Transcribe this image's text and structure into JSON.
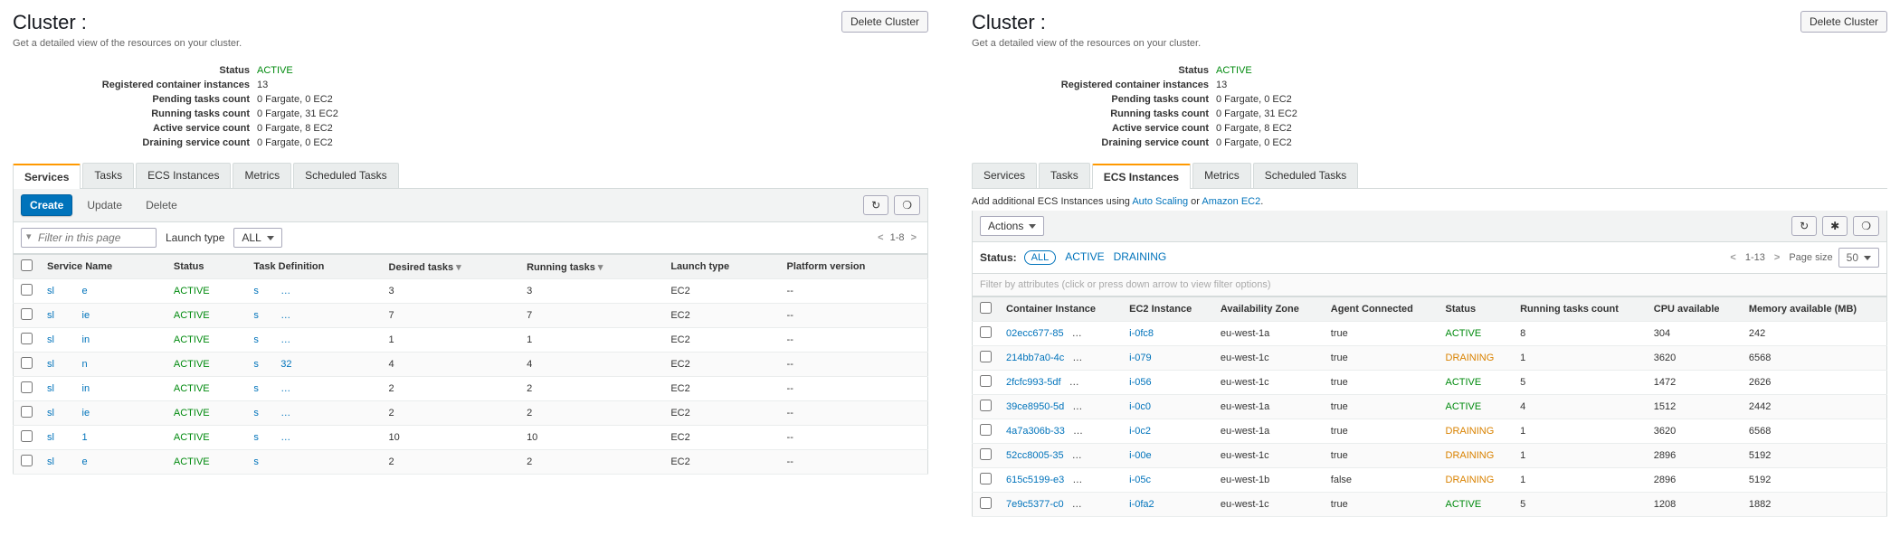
{
  "left": {
    "title": "Cluster :",
    "delete_btn": "Delete Cluster",
    "subtitle": "Get a detailed view of the resources on your cluster.",
    "meta": [
      {
        "label": "Status",
        "value": "ACTIVE",
        "green": true
      },
      {
        "label": "Registered container instances",
        "value": "13"
      },
      {
        "label": "Pending tasks count",
        "value": "0 Fargate, 0 EC2"
      },
      {
        "label": "Running tasks count",
        "value": "0 Fargate, 31 EC2"
      },
      {
        "label": "Active service count",
        "value": "0 Fargate, 8 EC2"
      },
      {
        "label": "Draining service count",
        "value": "0 Fargate, 0 EC2"
      }
    ],
    "tabs": [
      "Services",
      "Tasks",
      "ECS Instances",
      "Metrics",
      "Scheduled Tasks"
    ],
    "active_tab": 0,
    "toolbar": {
      "create": "Create",
      "update": "Update",
      "delete": "Delete"
    },
    "filter": {
      "placeholder": "Filter in this page",
      "launch_label": "Launch type",
      "launch_value": "ALL",
      "pager": "1-8"
    },
    "cols": [
      "",
      "Service Name",
      "Status",
      "Task Definition",
      "Desired tasks",
      "Running tasks",
      "Launch type",
      "Platform version"
    ],
    "sort_cols": [
      4,
      5
    ],
    "rows": [
      {
        "name_a": "sl",
        "name_b": "e",
        "status": "ACTIVE",
        "td_a": "s",
        "td_b": "…",
        "desired": "3",
        "running": "3",
        "launch": "EC2",
        "platform": "--"
      },
      {
        "name_a": "sl",
        "name_b": "ie",
        "status": "ACTIVE",
        "td_a": "s",
        "td_b": "…",
        "desired": "7",
        "running": "7",
        "launch": "EC2",
        "platform": "--"
      },
      {
        "name_a": "sl",
        "name_b": "in",
        "status": "ACTIVE",
        "td_a": "s",
        "td_b": "…",
        "desired": "1",
        "running": "1",
        "launch": "EC2",
        "platform": "--"
      },
      {
        "name_a": "sl",
        "name_b": "n",
        "status": "ACTIVE",
        "td_a": "s",
        "td_b": "32",
        "desired": "4",
        "running": "4",
        "launch": "EC2",
        "platform": "--"
      },
      {
        "name_a": "sl",
        "name_b": "in",
        "status": "ACTIVE",
        "td_a": "s",
        "td_b": "…",
        "desired": "2",
        "running": "2",
        "launch": "EC2",
        "platform": "--"
      },
      {
        "name_a": "sl",
        "name_b": "ie",
        "status": "ACTIVE",
        "td_a": "s",
        "td_b": "…",
        "desired": "2",
        "running": "2",
        "launch": "EC2",
        "platform": "--"
      },
      {
        "name_a": "sl",
        "name_b": "1",
        "status": "ACTIVE",
        "td_a": "s",
        "td_b": "…",
        "desired": "10",
        "running": "10",
        "launch": "EC2",
        "platform": "--"
      },
      {
        "name_a": "sl",
        "name_b": "e",
        "status": "ACTIVE",
        "td_a": "s",
        "td_b": "",
        "desired": "2",
        "running": "2",
        "launch": "EC2",
        "platform": "--"
      }
    ]
  },
  "right": {
    "title": "Cluster :",
    "delete_btn": "Delete Cluster",
    "subtitle": "Get a detailed view of the resources on your cluster.",
    "meta": [
      {
        "label": "Status",
        "value": "ACTIVE",
        "green": true
      },
      {
        "label": "Registered container instances",
        "value": "13"
      },
      {
        "label": "Pending tasks count",
        "value": "0 Fargate, 0 EC2"
      },
      {
        "label": "Running tasks count",
        "value": "0 Fargate, 31 EC2"
      },
      {
        "label": "Active service count",
        "value": "0 Fargate, 8 EC2"
      },
      {
        "label": "Draining service count",
        "value": "0 Fargate, 0 EC2"
      }
    ],
    "tabs": [
      "Services",
      "Tasks",
      "ECS Instances",
      "Metrics",
      "Scheduled Tasks"
    ],
    "active_tab": 2,
    "help_pre": "Add additional ECS Instances using ",
    "help_l1": "Auto Scaling",
    "help_mid": " or ",
    "help_l2": "Amazon EC2",
    "help_post": ".",
    "toolbar": {
      "actions": "Actions"
    },
    "status_label": "Status:",
    "status_filters": [
      "ALL",
      "ACTIVE",
      "DRAINING"
    ],
    "pager": "1-13",
    "page_size_label": "Page size",
    "page_size": "50",
    "filter_placeholder": "Filter by attributes (click or press down arrow to view filter options)",
    "cols": [
      "",
      "Container Instance",
      "EC2 Instance",
      "Availability Zone",
      "Agent Connected",
      "Status",
      "Running tasks count",
      "CPU available",
      "Memory available (MB)"
    ],
    "rows": [
      {
        "ci": "02ecc677-85",
        "ec2": "i-0fc8",
        "az": "eu-west-1a",
        "agent": "true",
        "status": "ACTIVE",
        "running": "8",
        "cpu": "304",
        "mem": "242"
      },
      {
        "ci": "214bb7a0-4c",
        "ec2": "i-079",
        "az": "eu-west-1c",
        "agent": "true",
        "status": "DRAINING",
        "running": "1",
        "cpu": "3620",
        "mem": "6568"
      },
      {
        "ci": "2fcfc993-5df",
        "ec2": "i-056",
        "az": "eu-west-1c",
        "agent": "true",
        "status": "ACTIVE",
        "running": "5",
        "cpu": "1472",
        "mem": "2626"
      },
      {
        "ci": "39ce8950-5d",
        "ec2": "i-0c0",
        "az": "eu-west-1a",
        "agent": "true",
        "status": "ACTIVE",
        "running": "4",
        "cpu": "1512",
        "mem": "2442"
      },
      {
        "ci": "4a7a306b-33",
        "ec2": "i-0c2",
        "az": "eu-west-1a",
        "agent": "true",
        "status": "DRAINING",
        "running": "1",
        "cpu": "3620",
        "mem": "6568"
      },
      {
        "ci": "52cc8005-35",
        "ec2": "i-00e",
        "az": "eu-west-1c",
        "agent": "true",
        "status": "DRAINING",
        "running": "1",
        "cpu": "2896",
        "mem": "5192"
      },
      {
        "ci": "615c5199-e3",
        "ec2": "i-05c",
        "az": "eu-west-1b",
        "agent": "false",
        "status": "DRAINING",
        "running": "1",
        "cpu": "2896",
        "mem": "5192"
      },
      {
        "ci": "7e9c5377-c0",
        "ec2": "i-0fa2",
        "az": "eu-west-1c",
        "agent": "true",
        "status": "ACTIVE",
        "running": "5",
        "cpu": "1208",
        "mem": "1882"
      }
    ]
  }
}
